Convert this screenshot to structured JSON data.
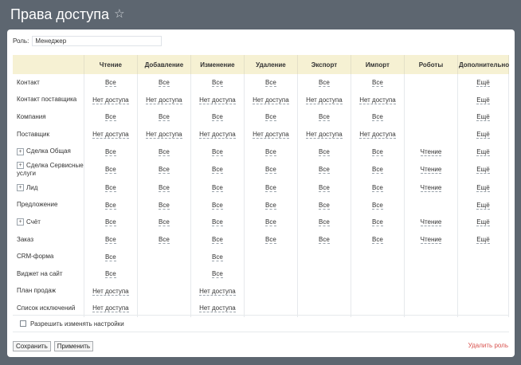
{
  "page": {
    "title": "Права доступа"
  },
  "role": {
    "label": "Роль:",
    "value": "Менеджер"
  },
  "table": {
    "headers": [
      "",
      "Чтение",
      "Добавление",
      "Изменение",
      "Удаление",
      "Экспорт",
      "Импорт",
      "Роботы",
      "Дополнительно"
    ],
    "rows": [
      {
        "entity": "Контакт",
        "expand": false,
        "cells": [
          "Все",
          "Все",
          "Все",
          "Все",
          "Все",
          "Все",
          "",
          "Ещё"
        ]
      },
      {
        "entity": "Контакт поставщика",
        "expand": false,
        "cells": [
          "Нет доступа",
          "Нет доступа",
          "Нет доступа",
          "Нет доступа",
          "Нет доступа",
          "Нет доступа",
          "",
          "Ещё"
        ]
      },
      {
        "entity": "Компания",
        "expand": false,
        "cells": [
          "Все",
          "Все",
          "Все",
          "Все",
          "Все",
          "Все",
          "",
          "Ещё"
        ]
      },
      {
        "entity": "Поставщик",
        "expand": false,
        "cells": [
          "Нет доступа",
          "Нет доступа",
          "Нет доступа",
          "Нет доступа",
          "Нет доступа",
          "Нет доступа",
          "",
          "Ещё"
        ]
      },
      {
        "entity": "Сделка Общая",
        "expand": true,
        "cells": [
          "Все",
          "Все",
          "Все",
          "Все",
          "Все",
          "Все",
          "Чтение",
          "Ещё"
        ]
      },
      {
        "entity": "Сделка Сервисные услуги",
        "expand": true,
        "cells": [
          "Все",
          "Все",
          "Все",
          "Все",
          "Все",
          "Все",
          "Чтение",
          "Ещё"
        ]
      },
      {
        "entity": "Лид",
        "expand": true,
        "cells": [
          "Все",
          "Все",
          "Все",
          "Все",
          "Все",
          "Все",
          "Чтение",
          "Ещё"
        ]
      },
      {
        "entity": "Предложение",
        "expand": false,
        "cells": [
          "Все",
          "Все",
          "Все",
          "Все",
          "Все",
          "Все",
          "",
          "Ещё"
        ]
      },
      {
        "entity": "Счёт",
        "expand": true,
        "cells": [
          "Все",
          "Все",
          "Все",
          "Все",
          "Все",
          "Все",
          "Чтение",
          "Ещё"
        ]
      },
      {
        "entity": "Заказ",
        "expand": false,
        "cells": [
          "Все",
          "Все",
          "Все",
          "Все",
          "Все",
          "Все",
          "Чтение",
          "Ещё"
        ]
      },
      {
        "entity": "CRM-форма",
        "expand": false,
        "cells": [
          "Все",
          "",
          "Все",
          "",
          "",
          "",
          "",
          ""
        ]
      },
      {
        "entity": "Виджет на сайт",
        "expand": false,
        "cells": [
          "Все",
          "",
          "Все",
          "",
          "",
          "",
          "",
          ""
        ]
      },
      {
        "entity": "План продаж",
        "expand": false,
        "cells": [
          "Нет доступа",
          "",
          "Нет доступа",
          "",
          "",
          "",
          "",
          ""
        ]
      },
      {
        "entity": "Список исключений",
        "expand": false,
        "cells": [
          "Нет доступа",
          "",
          "Нет доступа",
          "",
          "",
          "",
          "",
          ""
        ]
      }
    ]
  },
  "settings": {
    "allow_change_label": "Разрешить изменять настройки"
  },
  "buttons": {
    "save": "Сохранить",
    "apply": "Применить",
    "delete_role": "Удалить роль"
  }
}
